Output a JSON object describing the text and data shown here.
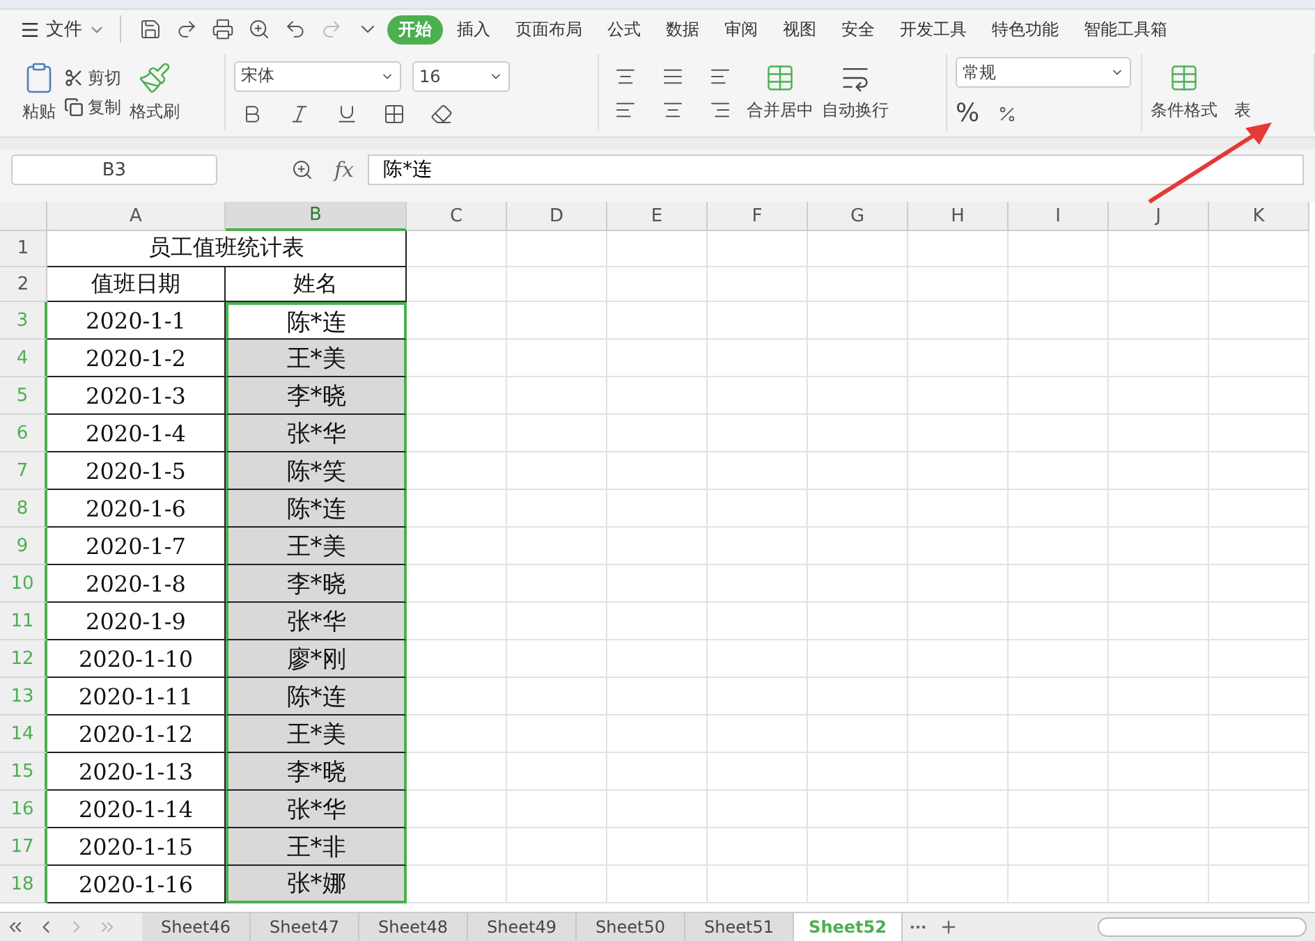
{
  "menu": {
    "file": "文件",
    "tabs": [
      {
        "label": "开始",
        "selected": true
      },
      {
        "label": "插入",
        "selected": false
      },
      {
        "label": "页面布局",
        "selected": false
      },
      {
        "label": "公式",
        "selected": false
      },
      {
        "label": "数据",
        "selected": false
      },
      {
        "label": "审阅",
        "selected": false
      },
      {
        "label": "视图",
        "selected": false
      },
      {
        "label": "安全",
        "selected": false
      },
      {
        "label": "开发工具",
        "selected": false
      },
      {
        "label": "特色功能",
        "selected": false
      },
      {
        "label": "智能工具箱",
        "selected": false
      }
    ]
  },
  "ribbon": {
    "paste": "粘贴",
    "cut": "剪切",
    "copy": "复制",
    "format_painter": "格式刷",
    "font": "宋体",
    "font_size": "16",
    "merge_center": "合并居中",
    "wrap_text": "自动换行",
    "number_format": "常规",
    "percent": "%",
    "conditional_format": "条件格式",
    "table_style": "表"
  },
  "formula_bar": {
    "name_box": "B3",
    "fx": "fx",
    "value": "陈*连"
  },
  "columns": [
    {
      "label": "A",
      "selected": false
    },
    {
      "label": "B",
      "selected": true
    },
    {
      "label": "C",
      "selected": false
    },
    {
      "label": "D",
      "selected": false
    },
    {
      "label": "E",
      "selected": false
    },
    {
      "label": "F",
      "selected": false
    },
    {
      "label": "G",
      "selected": false
    },
    {
      "label": "H",
      "selected": false
    },
    {
      "label": "I",
      "selected": false
    },
    {
      "label": "J",
      "selected": false
    },
    {
      "label": "K",
      "selected": false
    }
  ],
  "sheet": {
    "title": {
      "row": "1",
      "text": "员工值班统计表"
    },
    "header": {
      "row": "2",
      "date": "值班日期",
      "name": "姓名"
    },
    "rows": [
      {
        "row": "3",
        "date": "2020-1-1",
        "name": "陈*连",
        "selected": true
      },
      {
        "row": "4",
        "date": "2020-1-2",
        "name": "王*美",
        "selected": true
      },
      {
        "row": "5",
        "date": "2020-1-3",
        "name": "李*晓",
        "selected": true
      },
      {
        "row": "6",
        "date": "2020-1-4",
        "name": "张*华",
        "selected": true
      },
      {
        "row": "7",
        "date": "2020-1-5",
        "name": "陈*笑",
        "selected": true
      },
      {
        "row": "8",
        "date": "2020-1-6",
        "name": "陈*连",
        "selected": true
      },
      {
        "row": "9",
        "date": "2020-1-7",
        "name": "王*美",
        "selected": true
      },
      {
        "row": "10",
        "date": "2020-1-8",
        "name": "李*晓",
        "selected": true
      },
      {
        "row": "11",
        "date": "2020-1-9",
        "name": "张*华",
        "selected": true
      },
      {
        "row": "12",
        "date": "2020-1-10",
        "name": "廖*刚",
        "selected": true
      },
      {
        "row": "13",
        "date": "2020-1-11",
        "name": "陈*连",
        "selected": true
      },
      {
        "row": "14",
        "date": "2020-1-12",
        "name": "王*美",
        "selected": true
      },
      {
        "row": "15",
        "date": "2020-1-13",
        "name": "李*晓",
        "selected": true
      },
      {
        "row": "16",
        "date": "2020-1-14",
        "name": "张*华",
        "selected": true
      },
      {
        "row": "17",
        "date": "2020-1-15",
        "name": "王*非",
        "selected": true
      },
      {
        "row": "18",
        "date": "2020-1-16",
        "name": "张*娜",
        "selected": true
      }
    ]
  },
  "sheet_tabs": [
    {
      "label": "Sheet46",
      "selected": false
    },
    {
      "label": "Sheet47",
      "selected": false
    },
    {
      "label": "Sheet48",
      "selected": false
    },
    {
      "label": "Sheet49",
      "selected": false
    },
    {
      "label": "Sheet50",
      "selected": false
    },
    {
      "label": "Sheet51",
      "selected": false
    },
    {
      "label": "Sheet52",
      "selected": true
    }
  ]
}
